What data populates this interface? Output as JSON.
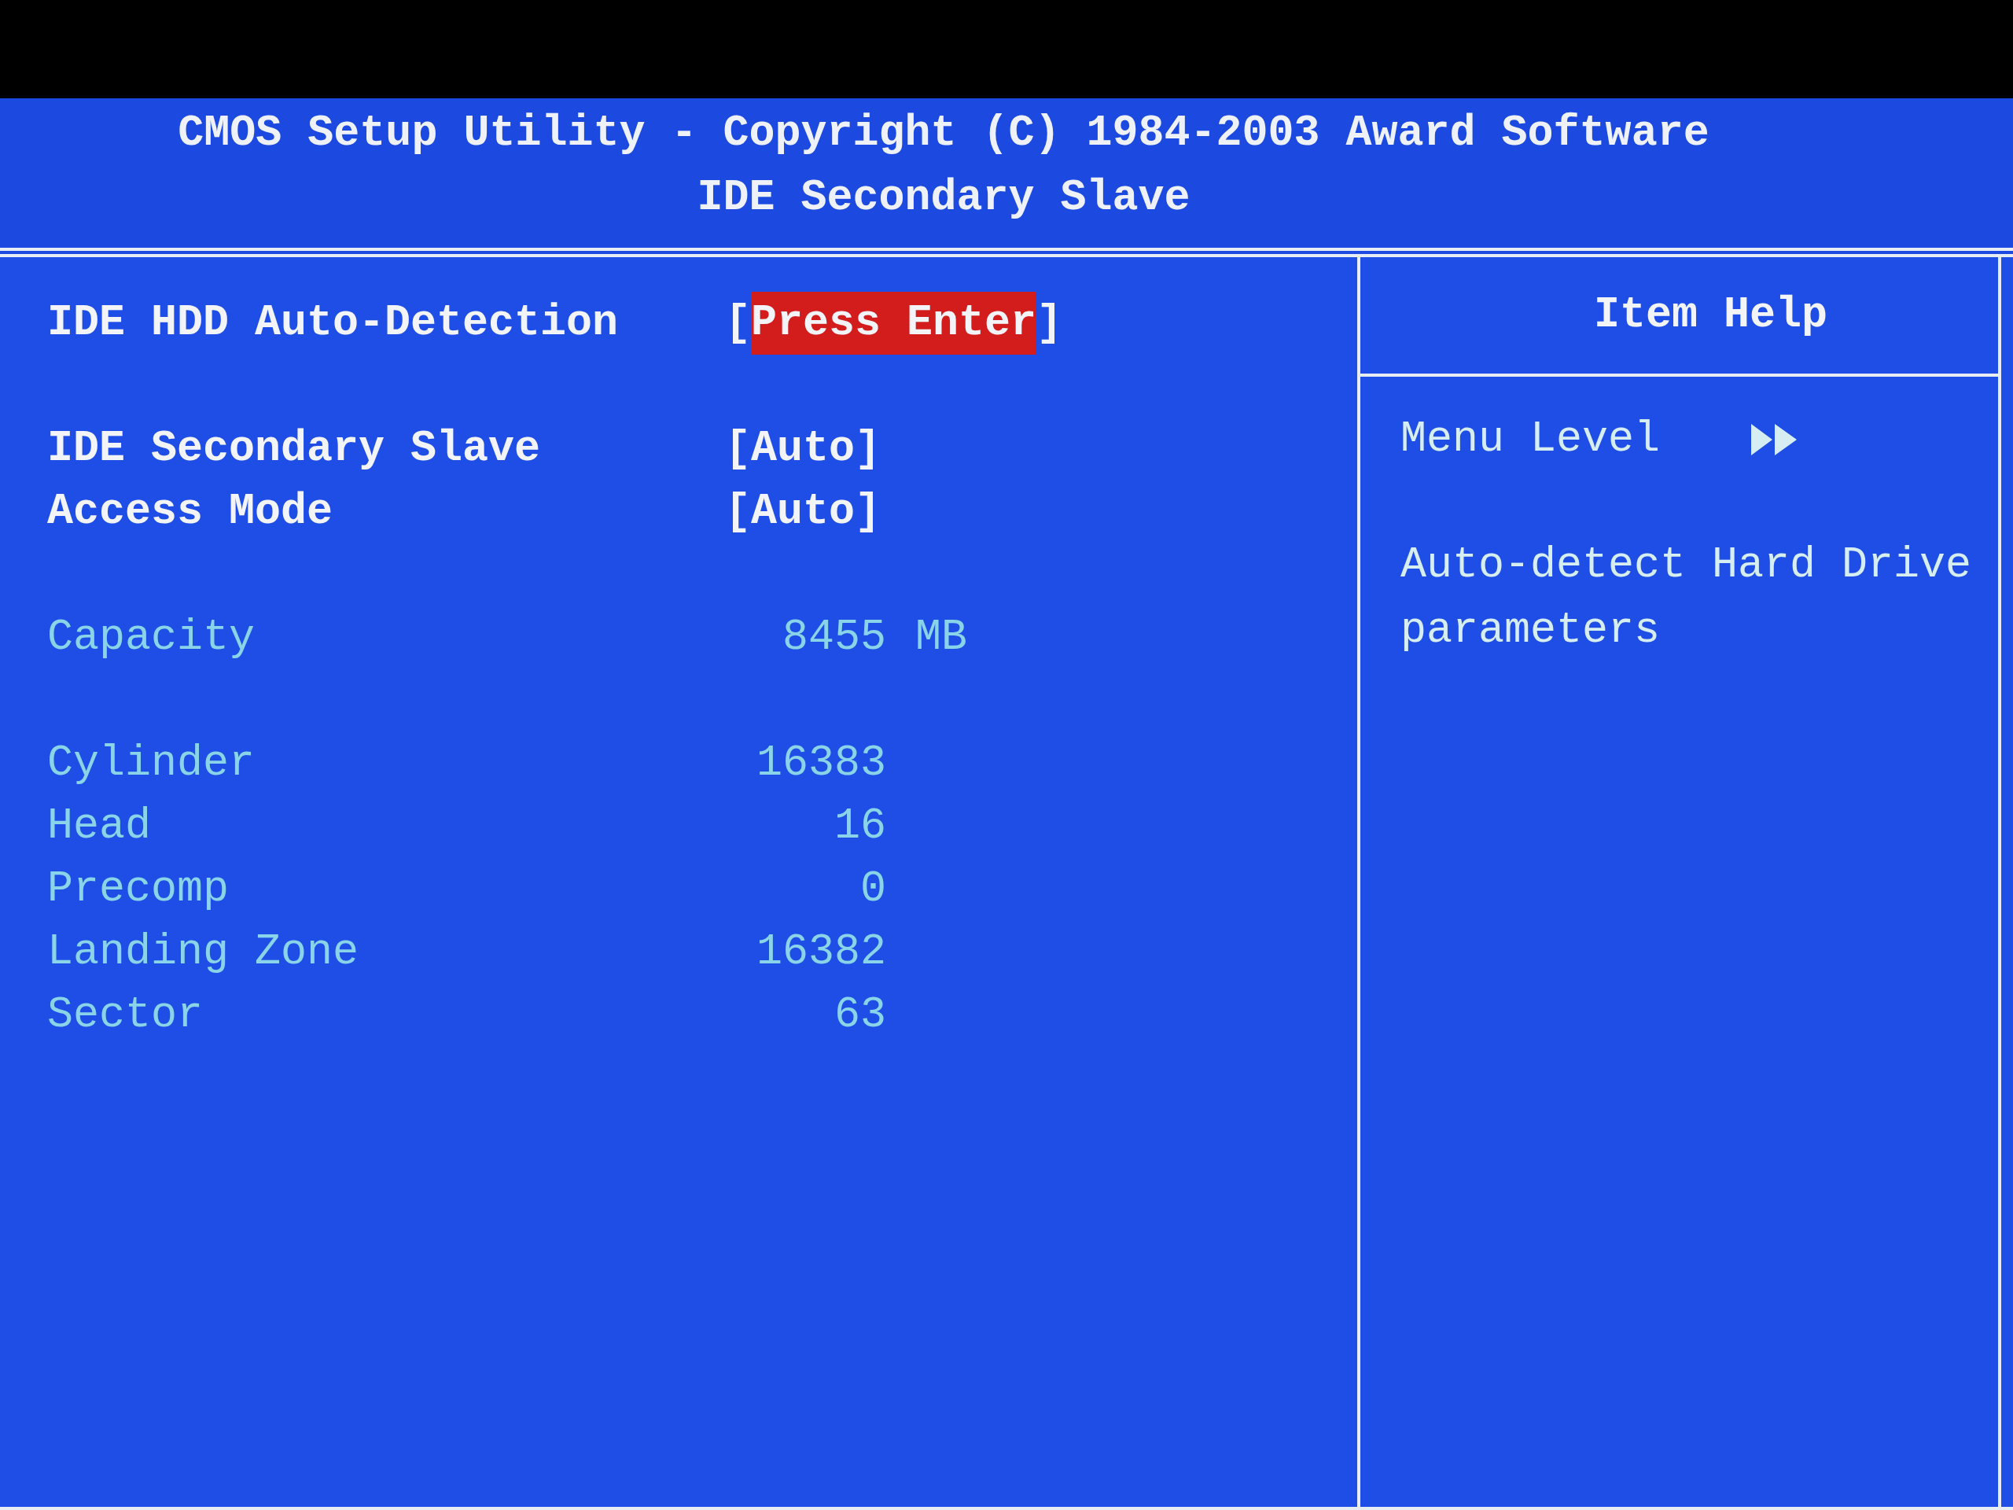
{
  "header": {
    "title": "CMOS Setup Utility - Copyright (C) 1984-2003 Award Software",
    "subtitle": "IDE Secondary Slave"
  },
  "sections": [
    {
      "items": [
        {
          "kind": "option",
          "label": "IDE HDD Auto-Detection",
          "open": "[",
          "value": "Press Enter",
          "close": "]",
          "selected": true
        }
      ]
    },
    {
      "items": [
        {
          "kind": "option",
          "label": "IDE Secondary Slave",
          "open": "[",
          "value": "Auto",
          "close": "]",
          "selected": false
        },
        {
          "kind": "option",
          "label": "Access Mode",
          "open": "[",
          "value": "Auto",
          "close": "]",
          "selected": false
        }
      ]
    },
    {
      "items": [
        {
          "kind": "info",
          "label": "Capacity",
          "value": "8455",
          "unit": "MB"
        }
      ]
    },
    {
      "items": [
        {
          "kind": "info",
          "label": "Cylinder",
          "value": "16383"
        },
        {
          "kind": "info",
          "label": "Head",
          "value": "16"
        },
        {
          "kind": "info",
          "label": "Precomp",
          "value": "0"
        },
        {
          "kind": "info",
          "label": "Landing Zone",
          "value": "16382"
        },
        {
          "kind": "info",
          "label": "Sector",
          "value": "63"
        }
      ]
    }
  ],
  "item_help": {
    "title": "Item Help",
    "menu_level": "Menu Level",
    "description": "Auto-detect Hard Drive parameters"
  }
}
